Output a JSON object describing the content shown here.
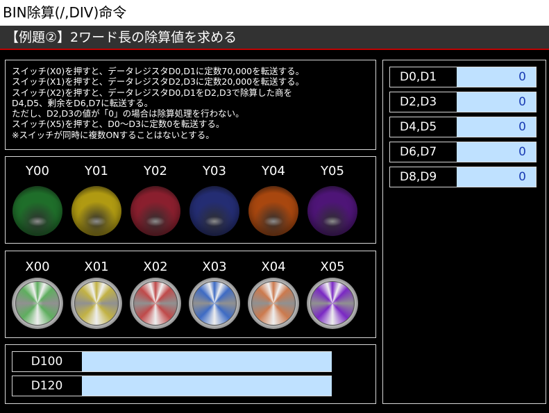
{
  "app": {
    "title": "BIN除算(/,DIV)命令",
    "subtitle": "【例題②】2ワード長の除算値を求める"
  },
  "description": [
    "スイッチ(X0)を押すと、データレジスタD0,D1に定数70,000を転送する。",
    "スイッチ(X1)を押すと、データレジスタD2,D3に定数20,000を転送する。",
    "スイッチ(X2)を押すと、データレジスタD0,D1をD2,D3で除算した商を",
    "D4,D5、剰余をD6,D7に転送する。",
    "ただし、D2,D3の値が「0」の場合は除算処理を行わない。",
    "スイッチ(X5)を押すと、D0～D3に定数0を転送する。",
    "※スイッチが同時に複数ONすることはないとする。"
  ],
  "lamps": [
    {
      "label": "Y00",
      "color": "#1f6e2a",
      "icon": "green-lamp-icon"
    },
    {
      "label": "Y01",
      "color": "#b09a12",
      "icon": "yellow-lamp-icon"
    },
    {
      "label": "Y02",
      "color": "#8a1f2e",
      "icon": "red-lamp-icon"
    },
    {
      "label": "Y03",
      "color": "#242d73",
      "icon": "blue-lamp-icon"
    },
    {
      "label": "Y04",
      "color": "#a8470f",
      "icon": "orange-lamp-icon"
    },
    {
      "label": "Y05",
      "color": "#4e1577",
      "icon": "purple-lamp-icon"
    }
  ],
  "switches": [
    {
      "label": "X00",
      "color": "#5fae5f",
      "icon": "green-switch-icon"
    },
    {
      "label": "X01",
      "color": "#c2b245",
      "icon": "yellow-switch-icon"
    },
    {
      "label": "X02",
      "color": "#c04a4a",
      "icon": "red-switch-icon"
    },
    {
      "label": "X03",
      "color": "#3e6bc4",
      "icon": "blue-switch-icon"
    },
    {
      "label": "X04",
      "color": "#cc7a4e",
      "icon": "orange-switch-icon"
    },
    {
      "label": "X05",
      "color": "#7a28c4",
      "icon": "purple-switch-icon"
    }
  ],
  "registers": [
    {
      "name": "D100",
      "value": ""
    },
    {
      "name": "D120",
      "value": ""
    }
  ],
  "data_registers": [
    {
      "name": "D0,D1",
      "value": "0"
    },
    {
      "name": "D2,D3",
      "value": "0"
    },
    {
      "name": "D4,D5",
      "value": "0"
    },
    {
      "name": "D6,D7",
      "value": "0"
    },
    {
      "name": "D8,D9",
      "value": "0"
    }
  ],
  "colors": {
    "header_bar": "#323232",
    "header_rule": "#c00000",
    "value_field": "#bfe1ff",
    "value_text": "#1a3cb4"
  }
}
